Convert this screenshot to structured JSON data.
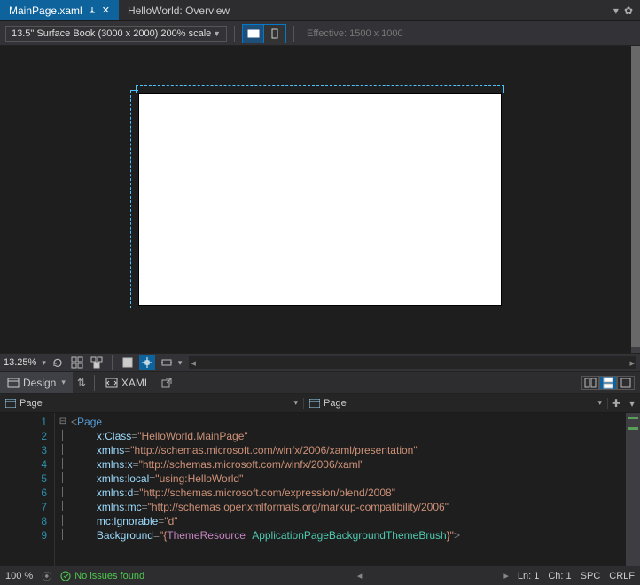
{
  "tabs": {
    "active": "MainPage.xaml",
    "second": "HelloWorld: Overview"
  },
  "toolbar": {
    "device": "13.5\" Surface Book (3000 x 2000) 200% scale",
    "effective": "Effective: 1500 x 1000"
  },
  "design_bottom": {
    "zoom": "13.25%"
  },
  "splitter": {
    "design_label": "Design",
    "xaml_label": "XAML"
  },
  "nav": {
    "left": "Page",
    "right": "Page"
  },
  "code": {
    "lines": [
      1,
      2,
      3,
      4,
      5,
      6,
      7,
      8,
      9
    ]
  },
  "xaml": {
    "class": "HelloWorld.MainPage",
    "xmlns": "http://schemas.microsoft.com/winfx/2006/xaml/presentation",
    "xmlns_x": "http://schemas.microsoft.com/winfx/2006/xaml",
    "xmlns_local": "using:HelloWorld",
    "xmlns_d": "http://schemas.microsoft.com/expression/blend/2008",
    "xmlns_mc": "http://schemas.openxmlformats.org/markup-compatibility/2006",
    "ignorable": "d",
    "bg_resource": "ApplicationPageBackgroundThemeBrush"
  },
  "status": {
    "zoom": "100 %",
    "issues": "No issues found",
    "line": "Ln: 1",
    "col": "Ch: 1",
    "spc": "SPC",
    "crlf": "CRLF"
  }
}
